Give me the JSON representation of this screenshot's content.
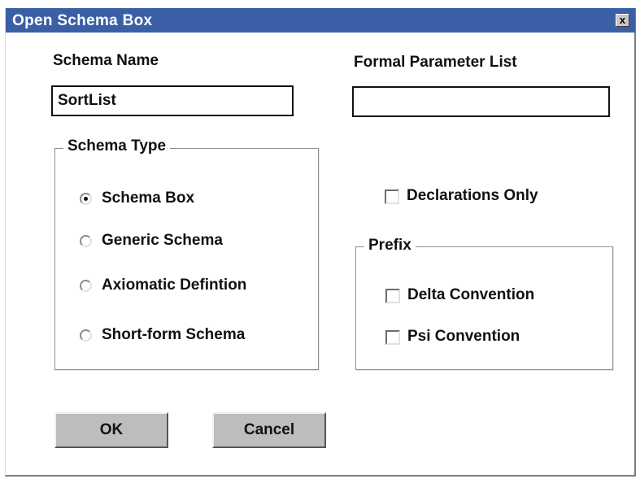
{
  "window": {
    "title": "Open Schema Box",
    "close_label": "x"
  },
  "schema_name": {
    "label": "Schema Name",
    "value": "SortList"
  },
  "formal_parameter_list": {
    "label": "Formal Parameter List",
    "value": ""
  },
  "schema_type": {
    "legend": "Schema Type",
    "selected": "Schema Box",
    "options": [
      {
        "label": "Schema Box",
        "checked": true
      },
      {
        "label": "Generic Schema",
        "checked": false
      },
      {
        "label": "Axiomatic Defintion",
        "checked": false
      },
      {
        "label": "Short-form Schema",
        "checked": false
      }
    ]
  },
  "declarations_only": {
    "label": "Declarations Only",
    "checked": false
  },
  "prefix": {
    "legend": "Prefix",
    "options": [
      {
        "label": "Delta Convention",
        "checked": false
      },
      {
        "label": "Psi Convention",
        "checked": false
      }
    ]
  },
  "buttons": {
    "ok": "OK",
    "cancel": "Cancel"
  }
}
